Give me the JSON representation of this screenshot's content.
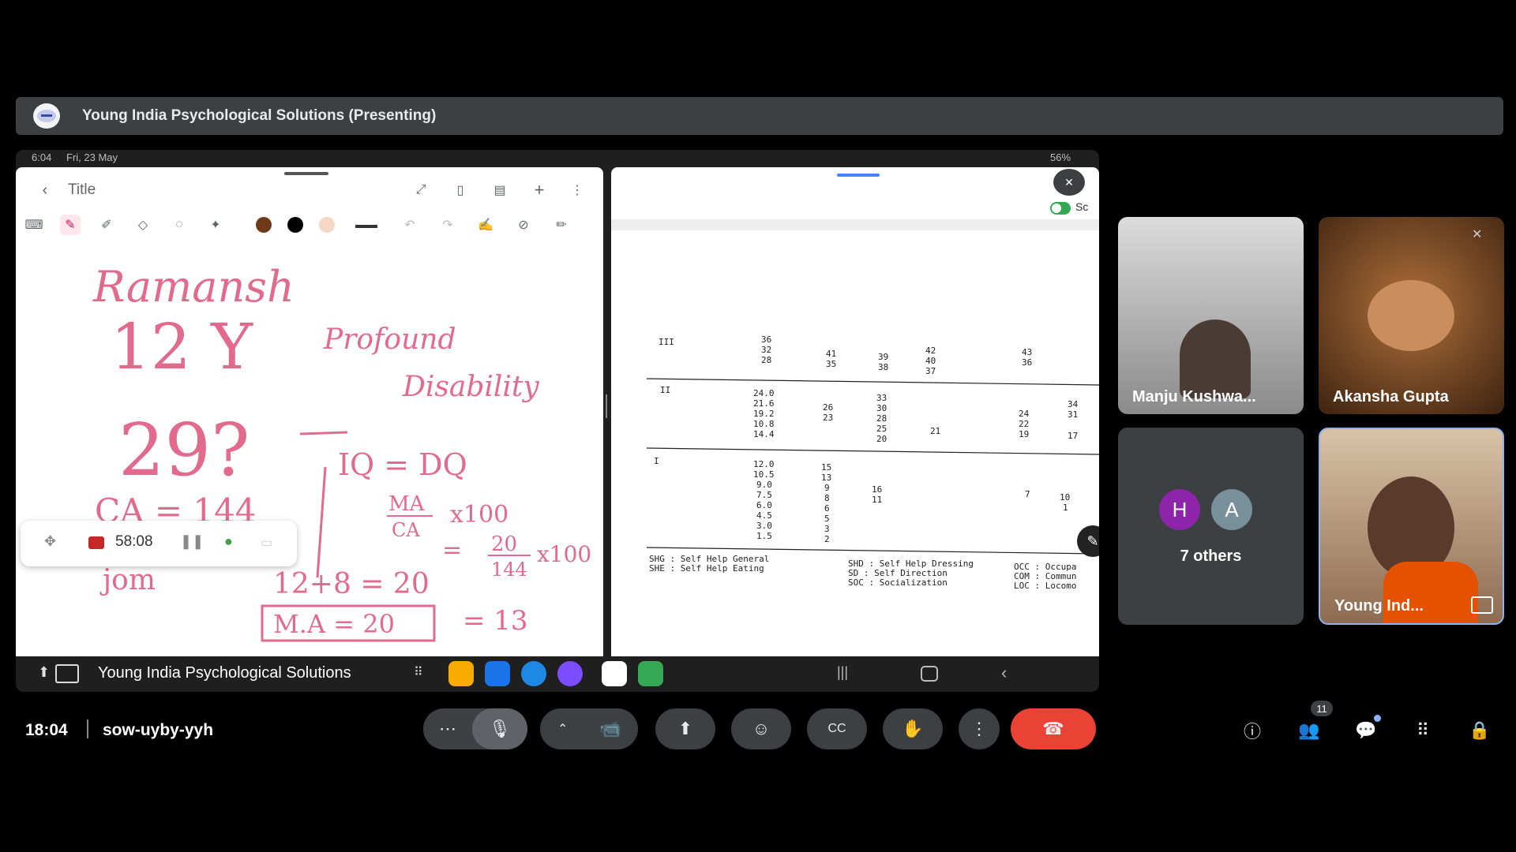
{
  "presenter": {
    "title": "Young India Psychological Solutions (Presenting)"
  },
  "tablet": {
    "status_time": "6:04",
    "status_date": "Fri, 23 May",
    "battery": "56%",
    "note_title": "Title",
    "recorder_time": "58:08",
    "taskbar_label": "Young India Psychological Solutions"
  },
  "handwriting": {
    "name": "Ramansh",
    "age": "12 Y",
    "diagnosis_1": "Profound",
    "diagnosis_2": "Disability",
    "score": "29?",
    "iq": "IQ = DQ",
    "ca": "CA = 144",
    "ma_formula_top": "MA",
    "ma_formula_bottom": "CA",
    "x100": "x100",
    "eq_top": "20",
    "eq_bottom": "144",
    "eq_x100": "x100",
    "sum": "12+8 = 20",
    "ma_box": "M.A = 20",
    "result": "= 13",
    "partial": "jom"
  },
  "document": {
    "rows": [
      {
        "level": "III",
        "cols": [
          "36\n32\n28",
          "41\n35",
          "39\n38",
          "42\n40\n37",
          "43\n36"
        ]
      },
      {
        "level": "II",
        "cols": [
          "24.0\n21.6\n19.2\n10.8\n14.4",
          "26\n23",
          "33\n30\n28\n25\n20",
          "21",
          "24\n22\n19",
          "34\n31\n17"
        ]
      },
      {
        "level": "I",
        "cols": [
          "12.0\n10.5\n9.0\n7.5\n6.0\n4.5\n3.0\n1.5",
          "15\n13\n9\n8\n6\n5\n3\n2",
          "16\n11",
          "7",
          "10\n1"
        ]
      }
    ],
    "legend_1": "SHG : Self Help General",
    "legend_2": "SHE : Self Help Eating",
    "legend_3": "SHD : Self Help Dressing",
    "legend_4": "SD  : Self Direction",
    "legend_5": "SOC : Socialization",
    "legend_6": "OCC : Occupa",
    "legend_7": "COM : Commun",
    "legend_8": "LOC : Locomo",
    "toggle_label": "Sc"
  },
  "participants": [
    {
      "name": "Manju Kushwa..."
    },
    {
      "name": "Akansha Gupta"
    },
    {
      "name": "7 others",
      "initial_1": "H",
      "initial_2": "A"
    },
    {
      "name": "Young Ind..."
    }
  ],
  "meeting": {
    "time": "18:04",
    "code": "sow-uyby-yyh",
    "people_count": "11"
  },
  "colors": {
    "end_call": "#ea4335",
    "ink": "#e26a8c",
    "avatar_h": "#8e24aa",
    "avatar_a": "#78909c"
  }
}
